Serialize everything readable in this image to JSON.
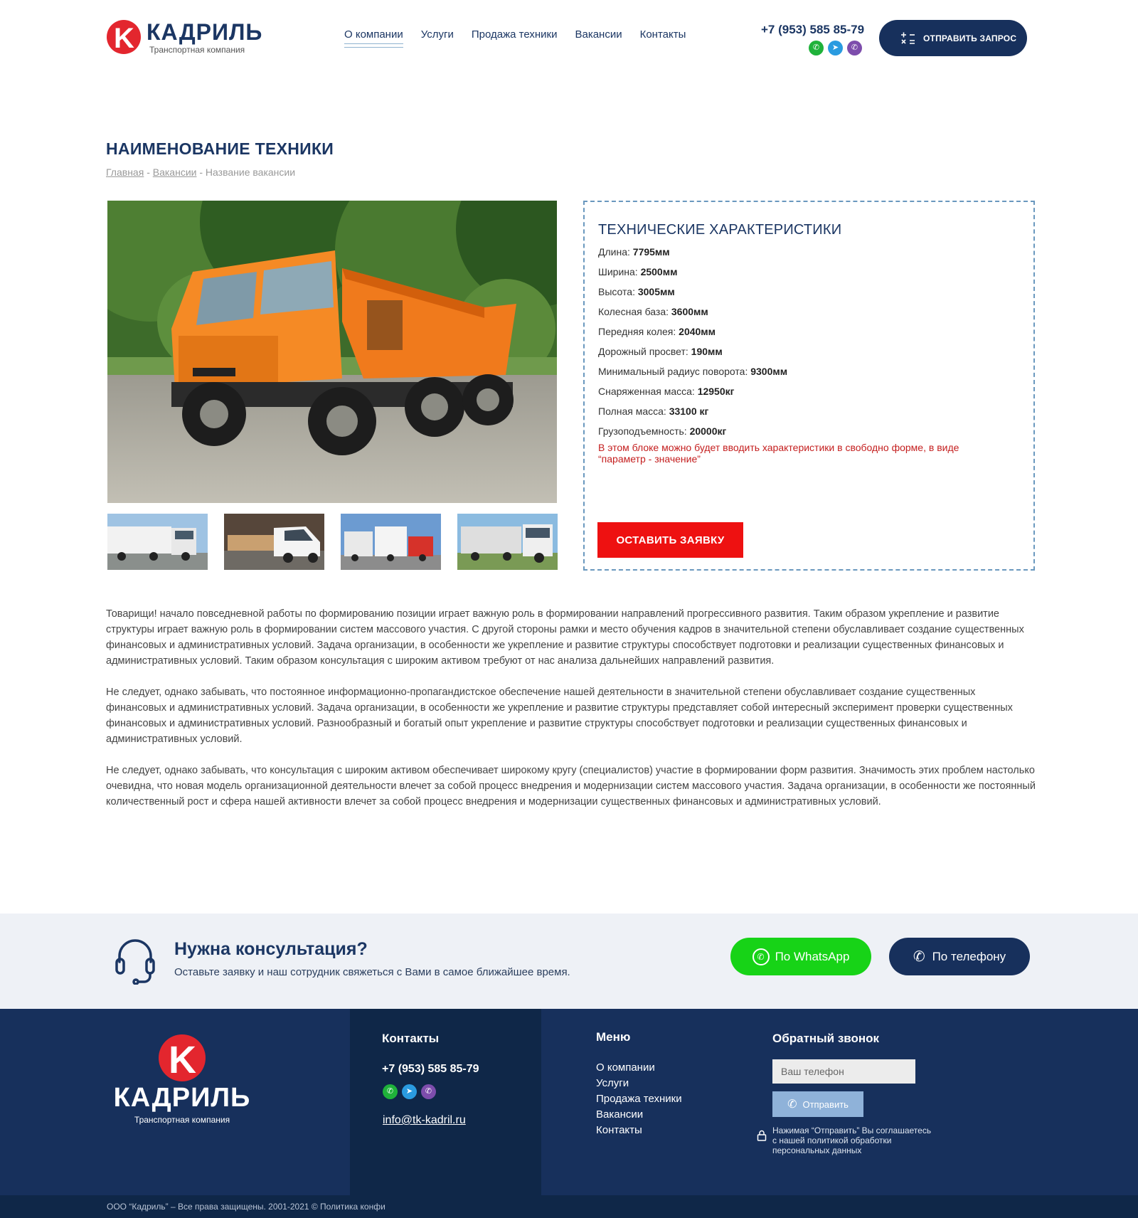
{
  "header": {
    "logo_letter": "K",
    "logo_name": "КАДРИЛЬ",
    "logo_sub": "Транспортная компания",
    "nav": [
      "О компании",
      "Услуги",
      "Продажа техники",
      "Вакансии",
      "Контакты"
    ],
    "phone": "+7 (953) 585 85-79",
    "request_button": "ОТПРАВИТЬ ЗАПРОС"
  },
  "page": {
    "title": "НАИМЕНОВАНИЕ ТЕХНИКИ",
    "breadcrumb": [
      "Главная",
      "Вакансии",
      "Название вакансии"
    ],
    "breadcrumb_sep": "-"
  },
  "specs": {
    "title": "ТЕХНИЧЕСКИЕ ХАРАКТЕРИСТИКИ",
    "rows": [
      {
        "label": "Длина:",
        "value": "7795мм"
      },
      {
        "label": "Ширина:",
        "value": "2500мм"
      },
      {
        "label": "Высота:",
        "value": "3005мм"
      },
      {
        "label": "Колесная база:",
        "value": "3600мм"
      },
      {
        "label": "Передняя колея:",
        "value": "2040мм"
      },
      {
        "label": "Дорожный просвет:",
        "value": "190мм"
      },
      {
        "label": "Минимальный радиус поворота:",
        "value": "9300мм"
      },
      {
        "label": "Снаряженная масса:",
        "value": "12950кг"
      },
      {
        "label": "Полная масса:",
        "value": "33100 кг"
      },
      {
        "label": "Грузоподъемность:",
        "value": "20000кг"
      }
    ],
    "note": "В этом блоке можно будет вводить характеристики в свободно форме, в виде “параметр - значение”",
    "order_button": "ОСТАВИТЬ ЗАЯВКУ"
  },
  "article": [
    "Товарищи! начало повседневной работы по формированию позиции играет важную роль в формировании направлений прогрессивного развития. Таким образом укрепление и развитие структуры играет важную роль в формировании систем массового участия. С другой стороны рамки и место обучения кадров в значительной степени обуславливает создание существенных финансовых и административных условий. Задача организации, в особенности же укрепление и развитие структуры способствует подготовки и реализации существенных финансовых и административных условий. Таким образом консультация с широким активом требуют от нас анализа дальнейших направлений развития.",
    "Не следует, однако забывать, что постоянное информационно-пропагандистское обеспечение нашей деятельности в значительной степени обуславливает создание существенных финансовых и административных условий. Задача организации, в особенности же укрепление и развитие структуры представляет собой интересный эксперимент проверки существенных финансовых и административных условий. Разнообразный и богатый опыт укрепление и развитие структуры способствует подготовки и реализации существенных финансовых и административных условий.",
    "Не следует, однако забывать, что консультация с широким активом обеспечивает широкому кругу (специалистов) участие в формировании форм развития. Значимость этих проблем настолько очевидна, что новая модель организационной деятельности влечет за собой процесс внедрения и модернизации систем массового участия. Задача организации, в особенности же постоянный количественный рост и сфера нашей активности влечет за собой процесс внедрения и модернизации существенных финансовых и административных условий."
  ],
  "consult": {
    "title": "Нужна консультация?",
    "text": "Оставьте заявку и наш сотрудник свяжеться с Вами в самое ближайшее время.",
    "whatsapp_button": "По WhatsApp",
    "phone_button": "По телефону"
  },
  "footer": {
    "logo_name": "КАДРИЛЬ",
    "logo_sub": "Транспортная компания",
    "contacts_title": "Контакты",
    "phone": "+7 (953) 585 85-79",
    "email": "info@tk-kadril.ru",
    "menu_title": "Меню",
    "menu": [
      "О компании",
      "Услуги",
      "Продажа техники",
      "Вакансии",
      "Контакты"
    ],
    "callback_title": "Обратный звонок",
    "callback_placeholder": "Ваш телефон",
    "callback_button": "Отправить",
    "callback_note": "Нажимая “Отправить” Вы соглашаетесь с нашей политикой обработки персональных данных",
    "copyright": "ООО “Кадриль” – Все права защищены.  2001-2021 © Политика конфи"
  },
  "colors": {
    "brand_navy": "#17305c",
    "brand_red": "#e3262e",
    "order_red": "#ee1111",
    "whatsapp_green": "#17d317"
  }
}
